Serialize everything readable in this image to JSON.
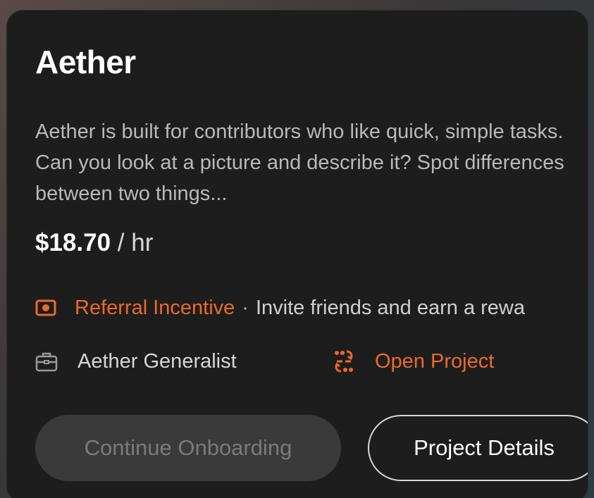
{
  "project": {
    "title": "Aether",
    "description": "Aether is built for contributors who like quick, simple tasks. Can you look at a picture and describe it? Spot differences between two things...",
    "rate_amount": "$18.70",
    "rate_unit": "/ hr"
  },
  "referral": {
    "icon": "cash-icon",
    "label": "Referral Incentive",
    "separator": "·",
    "text": "Invite friends and earn a rewa"
  },
  "role": {
    "icon": "briefcase-icon",
    "label": "Aether Generalist"
  },
  "open_project": {
    "icon": "open-project-icon",
    "label": "Open Project"
  },
  "buttons": {
    "continue_label": "Continue Onboarding",
    "details_label": "Project Details"
  },
  "colors": {
    "accent": "#ea6a2c",
    "card_background": "#1d1d1d",
    "muted_text": "#b9b9b9",
    "disabled_button": "#3a3a3a"
  }
}
